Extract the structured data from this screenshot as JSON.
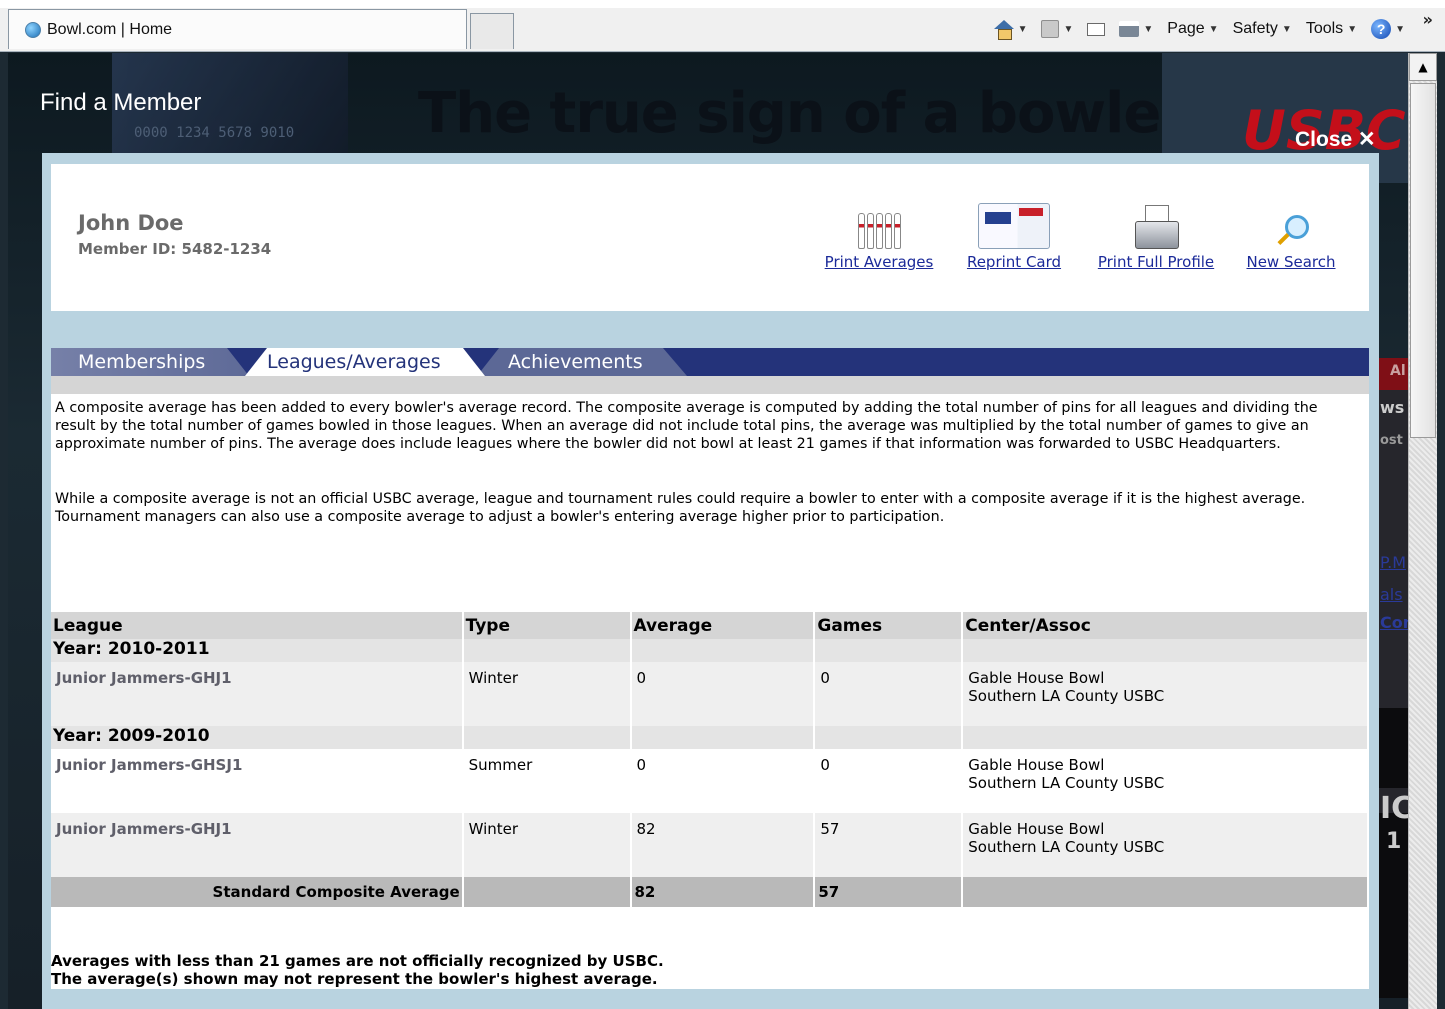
{
  "browser": {
    "tab_title": "Bowl.com | Home",
    "menu": {
      "page": "Page",
      "safety": "Safety",
      "tools": "Tools"
    },
    "chevron": "»"
  },
  "site": {
    "find_member": "Find a Member",
    "banner_tagline": "The true sign of a bowler.",
    "card_number": "0000 1234 5678 9010",
    "logo_text": "USBC",
    "close_label": "Close ✕",
    "side_fragments": [
      "Al",
      "ws",
      "ost",
      "P.M",
      "als",
      "Con",
      "IC",
      "1"
    ]
  },
  "member": {
    "name": "John Doe",
    "id_label": "Member ID: 5482-1234"
  },
  "actions": [
    {
      "label": "Print Averages",
      "icon": "bowling-pins-icon"
    },
    {
      "label": "Reprint Card",
      "icon": "member-card-icon"
    },
    {
      "label": "Print Full Profile",
      "icon": "printer-icon"
    },
    {
      "label": "New Search",
      "icon": "magnifier-icon"
    }
  ],
  "tabs": {
    "memberships": "Memberships",
    "leagues": "Leagues/Averages",
    "achievements": "Achievements",
    "active": "Leagues/Averages"
  },
  "description": {
    "p1": "A composite average has been added to every bowler's average record. The composite average is computed by adding the total number of pins for all leagues and dividing the result by the total number of games bowled in those leagues. When an average did not include total pins, the average was multiplied by the total number of games to give an approximate number of pins. The average does include leagues where the bowler did not bowl at least 21 games if that information was forwarded to USBC Headquarters.",
    "p2": "While a composite average is not an official USBC average, league and tournament rules could require a bowler to enter with a composite average if it is the highest average. Tournament managers can also use a composite average to adjust a bowler's entering average higher prior to participation."
  },
  "table": {
    "headers": {
      "league": "League",
      "type": "Type",
      "average": "Average",
      "games": "Games",
      "center": "Center/Assoc"
    },
    "year1": "Year: 2010-2011",
    "year2": "Year: 2009-2010",
    "rows": [
      {
        "league": "Junior Jammers-GHJ1",
        "type": "Winter",
        "average": "0",
        "games": "0",
        "center": "Gable House Bowl",
        "assoc": "Southern LA County USBC"
      },
      {
        "league": "Junior Jammers-GHSJ1",
        "type": "Summer",
        "average": "0",
        "games": "0",
        "center": "Gable House Bowl",
        "assoc": "Southern LA County USBC"
      },
      {
        "league": "Junior Jammers-GHJ1",
        "type": "Winter",
        "average": "82",
        "games": "57",
        "center": "Gable House Bowl",
        "assoc": "Southern LA County USBC"
      }
    ],
    "composite": {
      "label": "Standard Composite Average",
      "average": "82",
      "games": "57"
    }
  },
  "notes": {
    "line1": "Averages with less than 21 games are not officially recognized by USBC.",
    "line2": "The average(s) shown may not represent the bowler's highest average."
  },
  "colors": {
    "tab_bar": "#24337a",
    "link": "#1b2a99",
    "modal_frame": "#b9d3e0",
    "header_gray": "#d5d5d5"
  }
}
